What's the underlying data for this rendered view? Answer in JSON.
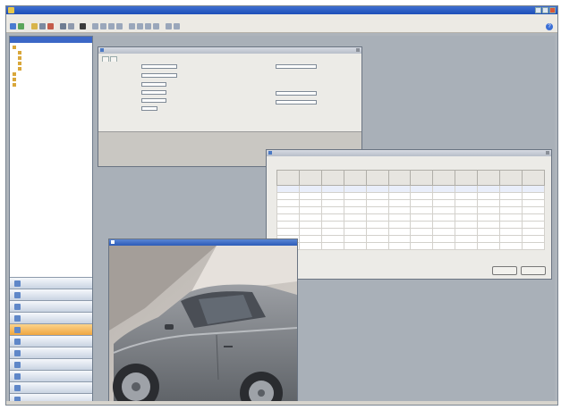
{
  "app": {
    "title": "",
    "menus": [
      "",
      "",
      "",
      "",
      "",
      ""
    ]
  },
  "sidebar": {
    "nav_items": [
      "",
      "",
      "",
      "",
      "",
      "",
      "",
      "",
      "",
      "",
      ""
    ],
    "active_index": 4
  },
  "form_window": {
    "title": "",
    "tabs": [
      "",
      ""
    ],
    "left_fields": [
      {
        "label": "",
        "value": ""
      },
      {
        "label": "",
        "value": ""
      },
      {
        "label": "",
        "value": ""
      },
      {
        "label": "",
        "value": ""
      },
      {
        "label": "",
        "value": ""
      },
      {
        "label": "",
        "value": ""
      }
    ],
    "right_fields": [
      {
        "label": "",
        "value": ""
      },
      {
        "label": "",
        "value": ""
      },
      {
        "label": "",
        "value": ""
      },
      {
        "label": "",
        "value": ""
      },
      {
        "label": "",
        "value": ""
      }
    ]
  },
  "grid_window": {
    "title": "",
    "columns": [
      "",
      "",
      "",
      "",
      "",
      "",
      "",
      "",
      "",
      "",
      "",
      ""
    ],
    "rows": 9,
    "buttons": [
      "",
      ""
    ]
  },
  "image_window": {
    "title": "",
    "subject": "silver-car-photo"
  },
  "colors": {
    "accent": "#1d4fb8",
    "active_nav": "#f0a640",
    "desktop": "#a9b0b8"
  }
}
